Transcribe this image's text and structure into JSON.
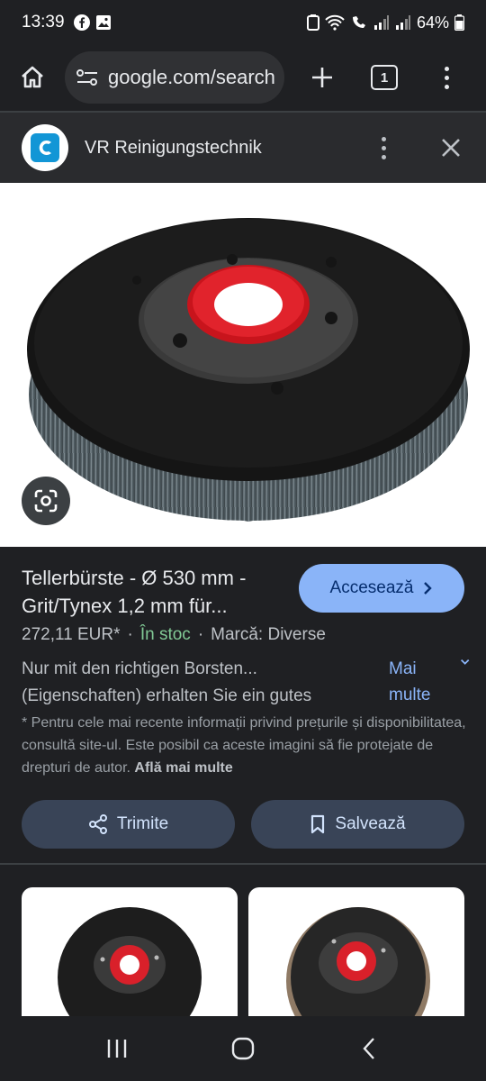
{
  "status": {
    "time": "13:39",
    "battery": "64%"
  },
  "browser": {
    "url": "google.com/search",
    "tab_count": "1"
  },
  "site": {
    "name": "VR Reinigungstechnik"
  },
  "product": {
    "title": "Tellerbürste - Ø 530 mm - Grit/Tynex 1,2 mm für...",
    "visit_label": "Accesează",
    "price": "272,11 EUR*",
    "stock": "În stoc",
    "brand": "Marcă: Diverse",
    "description": "Nur mit den richtigen Borsten... (Eigenschaften) erhalten Sie ein gutes",
    "more_label": "Mai multe",
    "disclaimer": "* Pentru cele mai recente informații privind prețurile și disponibilitatea, consultă site-ul. Este posibil ca aceste imagini să fie protejate de drepturi de autor.",
    "disclaimer_link": "Află mai multe"
  },
  "actions": {
    "share_label": "Trimite",
    "save_label": "Salvează"
  },
  "colors": {
    "accent": "#8ab4f8",
    "stock": "#81c995",
    "brush_red": "#d9202a"
  }
}
